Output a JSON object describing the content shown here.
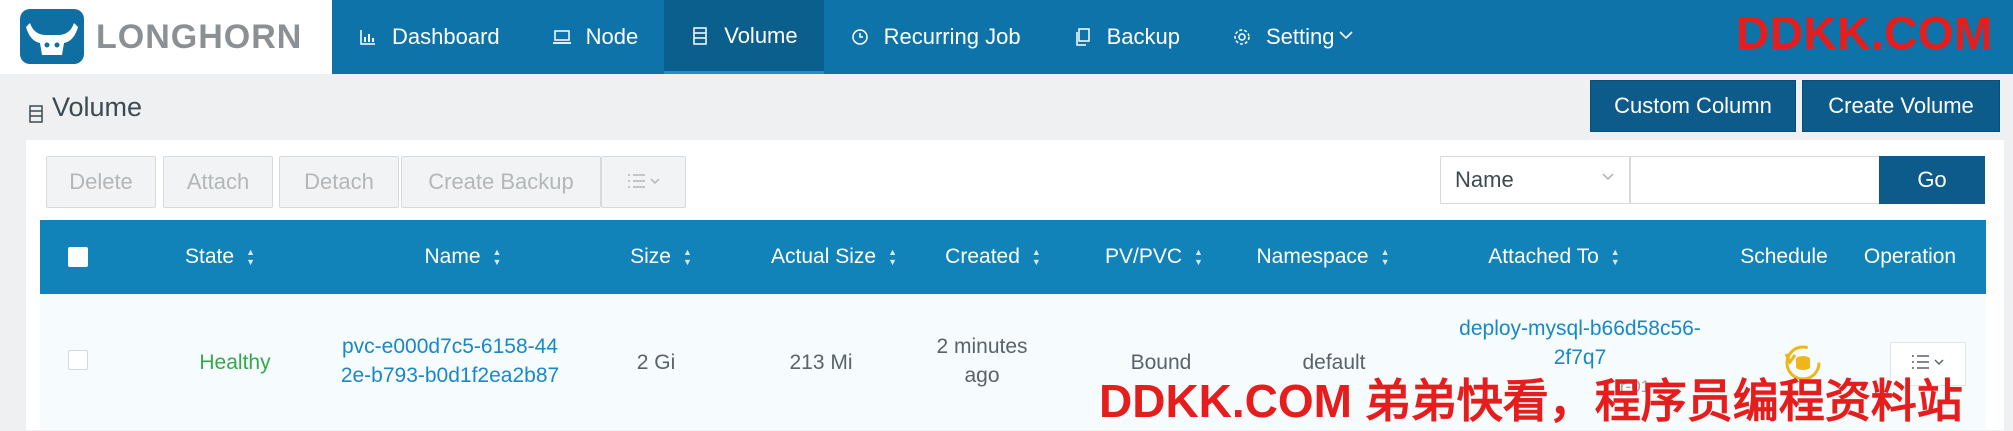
{
  "brand": {
    "name": "LONGHORN"
  },
  "nav": {
    "items": [
      {
        "label": "Dashboard",
        "icon": "bar-chart-icon"
      },
      {
        "label": "Node",
        "icon": "laptop-icon"
      },
      {
        "label": "Volume",
        "icon": "database-icon",
        "active": true
      },
      {
        "label": "Recurring Job",
        "icon": "clock-icon"
      },
      {
        "label": "Backup",
        "icon": "copy-icon"
      },
      {
        "label": "Setting",
        "icon": "gear-icon",
        "has_dropdown": true
      }
    ]
  },
  "watermark": {
    "top": "DDKK.COM",
    "bottom": "DDKK.COM 弟弟快看，程序员编程资料站"
  },
  "page": {
    "title": "Volume",
    "custom_column_label": "Custom Column",
    "create_volume_label": "Create Volume"
  },
  "toolbar": {
    "delete_label": "Delete",
    "attach_label": "Attach",
    "detach_label": "Detach",
    "create_backup_label": "Create Backup"
  },
  "search": {
    "field_selected": "Name",
    "input_value": "",
    "go_label": "Go"
  },
  "table": {
    "headers": {
      "state": "State",
      "name": "Name",
      "size": "Size",
      "actual_size": "Actual Size",
      "created": "Created",
      "pv_pvc": "PV/PVC",
      "namespace": "Namespace",
      "attached_to": "Attached To",
      "schedule": "Schedule",
      "operation": "Operation"
    },
    "rows": [
      {
        "state": "Healthy",
        "name_line1": "pvc-e000d7c5-6158-44",
        "name_line2": "2e-b793-b0d1f2ea2b87",
        "size": "2 Gi",
        "actual_size": "213 Mi",
        "created_line1": "2 minutes",
        "created_line2": "ago",
        "pv_pvc": "Bound",
        "namespace": "default",
        "attached_line1": "deploy-mysql-b66d58c56-",
        "attached_line2": "2f7q7",
        "attached_node_partial": "r-01"
      }
    ]
  },
  "colors": {
    "header_bg": "#0d73a8",
    "nav_active_bg": "#0b5f8c",
    "primary_button": "#0d5b8a",
    "table_header": "#1283b8",
    "healthy": "#36a84a",
    "link": "#1a87c7",
    "watermark": "#e51d1d"
  }
}
